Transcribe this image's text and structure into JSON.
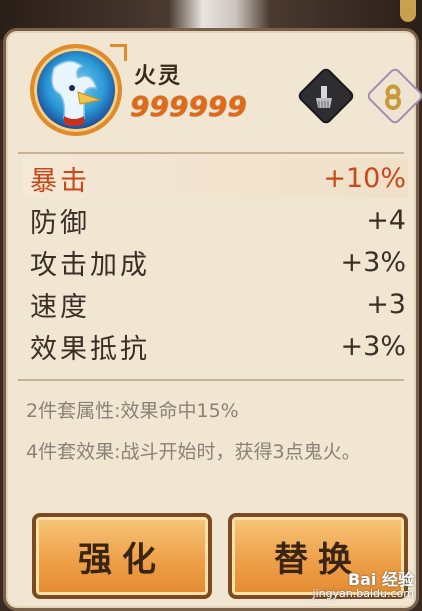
{
  "hero": {
    "name": "火灵",
    "score": "999999"
  },
  "icons": {
    "left": "brush-icon",
    "right": "number-eight-badge-icon"
  },
  "stats": [
    {
      "label": "暴击",
      "value": "+10%"
    },
    {
      "label": "防御",
      "value": "+4"
    },
    {
      "label": "攻击加成",
      "value": "+3%"
    },
    {
      "label": "速度",
      "value": "+3"
    },
    {
      "label": "效果抵抗",
      "value": "+3%"
    }
  ],
  "set_effects": {
    "two_piece": "2件套属性:效果命中15%",
    "four_piece": "4件套效果:战斗开始时，获得3点鬼火。"
  },
  "buttons": {
    "enhance": "强化",
    "replace": "替换"
  },
  "watermark": {
    "brand": "Bai 经验",
    "url": "jingyan.baidu.com"
  },
  "colors": {
    "highlight_stat": "#c8481a",
    "score": "#e06a18",
    "panel": "#f0e6d2",
    "button": "#eea14a"
  }
}
